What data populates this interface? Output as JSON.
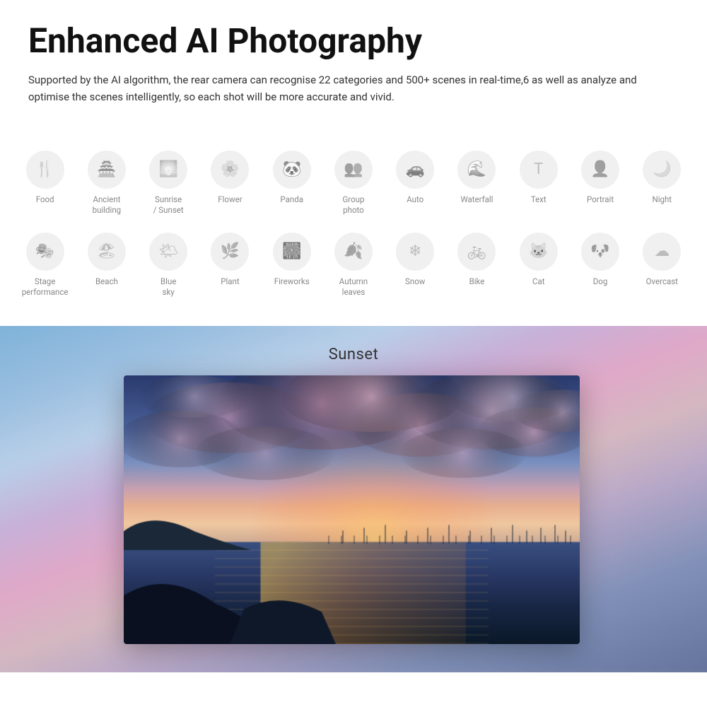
{
  "header": {
    "title": "Enhanced AI Photography",
    "description": "Supported by the AI algorithm, the rear camera can recognise 22 categories and 500+ scenes in real-time,6 as well as analyze and optimise the scenes intelligently, so each shot will be more accurate and vivid."
  },
  "categories": {
    "row1": [
      {
        "id": "food",
        "label": "Food",
        "icon": "🍴"
      },
      {
        "id": "ancient-building",
        "label": "Ancient\nbuilding",
        "icon": "🏯"
      },
      {
        "id": "sunrise-sunset",
        "label": "Sunrise\n/ Sunset",
        "icon": "🌅"
      },
      {
        "id": "flower",
        "label": "Flower",
        "icon": "🌸"
      },
      {
        "id": "panda",
        "label": "Panda",
        "icon": "🐼"
      },
      {
        "id": "group-photo",
        "label": "Group\nphoto",
        "icon": "👥"
      },
      {
        "id": "auto",
        "label": "Auto",
        "icon": "🚗"
      },
      {
        "id": "waterfall",
        "label": "Waterfall",
        "icon": "🌊"
      },
      {
        "id": "text",
        "label": "Text",
        "icon": "T"
      },
      {
        "id": "portrait",
        "label": "Portrait",
        "icon": "👤"
      },
      {
        "id": "night",
        "label": "Night",
        "icon": "🌙"
      }
    ],
    "row2": [
      {
        "id": "stage-performance",
        "label": "Stage\nperformance",
        "icon": "🎭"
      },
      {
        "id": "beach",
        "label": "Beach",
        "icon": "🏖"
      },
      {
        "id": "blue-sky",
        "label": "Blue\nsky",
        "icon": "🌤"
      },
      {
        "id": "plant",
        "label": "Plant",
        "icon": "🌿"
      },
      {
        "id": "fireworks",
        "label": "Fireworks",
        "icon": "🎆"
      },
      {
        "id": "autumn-leaves",
        "label": "Autumn\nleaves",
        "icon": "🍂"
      },
      {
        "id": "snow",
        "label": "Snow",
        "icon": "❄"
      },
      {
        "id": "bike",
        "label": "Bike",
        "icon": "🚲"
      },
      {
        "id": "cat",
        "label": "Cat",
        "icon": "🐱"
      },
      {
        "id": "dog",
        "label": "Dog",
        "icon": "🐶"
      },
      {
        "id": "overcast",
        "label": "Overcast",
        "icon": "☁"
      }
    ]
  },
  "image_section": {
    "label": "Sunset"
  }
}
